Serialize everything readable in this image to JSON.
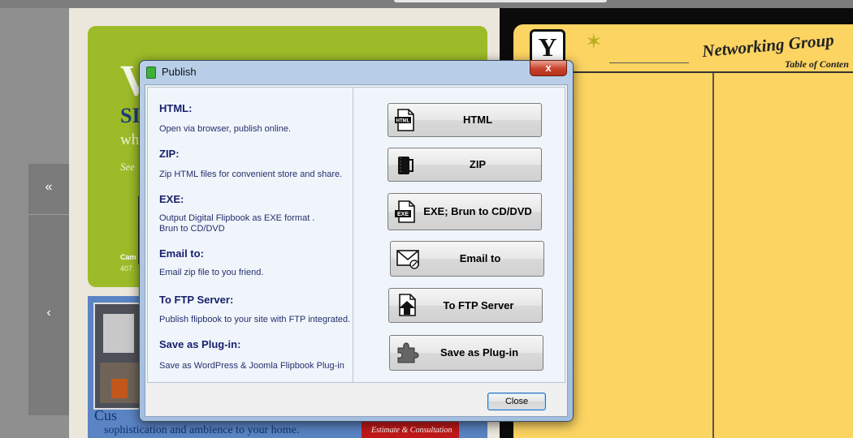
{
  "dialog": {
    "title": "Publish",
    "close_glyph": "x",
    "close_button_label": "Close"
  },
  "options": [
    {
      "heading": "HTML:",
      "desc_lines": [
        "Open via browser, publish online."
      ],
      "button_label": "HTML",
      "icon": "html-file-icon"
    },
    {
      "heading": "ZIP:",
      "desc_lines": [
        "Zip HTML files for convenient store and share."
      ],
      "button_label": "ZIP",
      "icon": "zip-archive-icon"
    },
    {
      "heading": "EXE:",
      "desc_lines": [
        "Output Digital Flipbook as EXE format .",
        "Brun to CD/DVD"
      ],
      "button_label": "EXE; Brun to CD/DVD",
      "icon": "exe-file-icon"
    },
    {
      "heading": "Email to:",
      "desc_lines": [
        "Email zip file to you friend."
      ],
      "button_label": "Email to",
      "icon": "envelope-icon"
    },
    {
      "heading": "To FTP Server:",
      "desc_lines": [
        "Publish flipbook to your site with FTP integrated."
      ],
      "button_label": "To FTP Server",
      "icon": "upload-file-icon"
    },
    {
      "heading": "Save as Plug-in:",
      "desc_lines": [
        "Save as WordPress & Joomla Flipbook Plug-in"
      ],
      "button_label": "Save as Plug-in",
      "icon": "puzzle-piece-icon"
    }
  ],
  "background": {
    "nav": {
      "first_glyph": "«",
      "prev_glyph": "‹"
    },
    "left_page": {
      "letter_v": "V",
      "line1": "SI",
      "line2": "wh",
      "line3": "See",
      "caption1": "Cam",
      "caption2": "407.",
      "bottom_text1": "Cus",
      "bottom_text2": "sophistication and ambience to your home.",
      "badge_text1": "—— — — ——— —— ——",
      "badge_text2": "Estimate & Consultation"
    },
    "right_page": {
      "logo_letter": "Y",
      "title": "Networking Group",
      "subtitle": "Table of Conten"
    }
  },
  "colors": {
    "dialog_frame": "#a4bedf",
    "close_x_red": "#c7412a",
    "heading_text": "#171f6b",
    "right_page_yellow": "#fcd462",
    "left_panel_green": "#9dbb28"
  }
}
